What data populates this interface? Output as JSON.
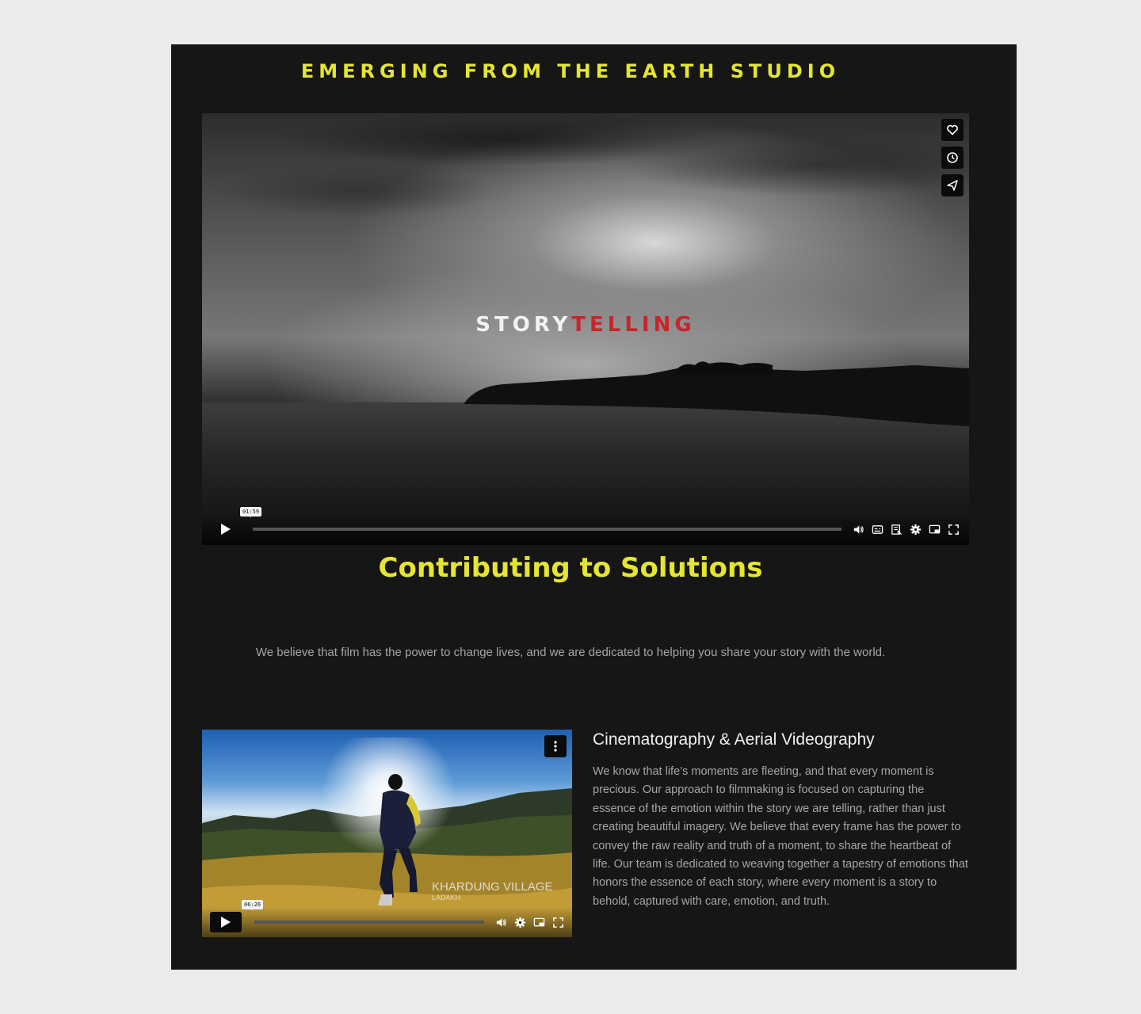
{
  "header": {
    "studio_title": "EMERGING FROM THE EARTH STUDIO"
  },
  "main_video": {
    "overlay_white": "STORY",
    "overlay_red": "TELLING",
    "timestamp": "01:59",
    "side_actions": [
      "heart-icon",
      "clock-icon",
      "send-icon"
    ],
    "control_icons": [
      "volume-icon",
      "captions-icon",
      "chapters-icon",
      "settings-icon",
      "pip-icon",
      "fullscreen-icon"
    ]
  },
  "hero": {
    "headline": "Contributing to Solutions",
    "tagline": "We believe that film has the power to change lives, and we are dedicated to helping you share your story with the world."
  },
  "feature": {
    "video": {
      "location": "KHARDUNG VILLAGE",
      "location_sub": "LADAKH",
      "timestamp": "06:26",
      "control_icons": [
        "volume-icon",
        "settings-icon",
        "pip-icon",
        "fullscreen-icon"
      ]
    },
    "title": "Cinematography & Aerial Videography",
    "body": "We know that life’s moments are fleeting, and that every moment is precious. Our approach to filmmaking is focused on capturing the essence of the emotion within the story we are telling, rather than just creating beautiful imagery. We believe that every frame has the power to convey the raw reality and truth of a moment, to share the heartbeat of life. Our team is dedicated to weaving together a tapestry of emotions that honors the essence of each story, where every moment is a story to behold, captured with care, emotion, and truth."
  },
  "colors": {
    "accent": "#e5e62f",
    "panel": "#161616",
    "page": "#ebebeb",
    "overlay_red": "#c8242b"
  }
}
